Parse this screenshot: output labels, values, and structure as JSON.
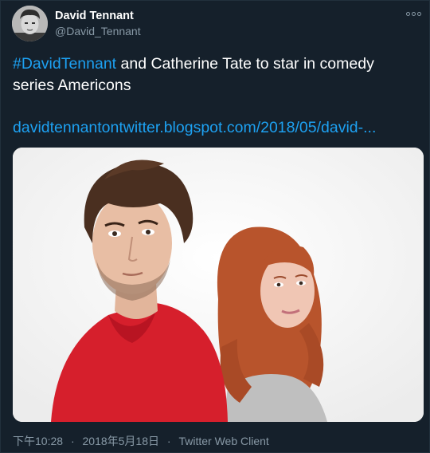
{
  "author": {
    "display_name": "David Tennant",
    "handle": "@David_Tennant",
    "avatar_icon": "avatar-photo"
  },
  "tweet": {
    "hashtag": "#DavidTennant",
    "text_rest": " and Catherine Tate to star in comedy series Americons",
    "link": "davidtennantontwitter.blogspot.com/2018/05/david-..."
  },
  "footer": {
    "time": "下午10:28",
    "date": "2018年5月18日",
    "separator": "·",
    "client": "Twitter Web Client"
  },
  "colors": {
    "background": "#15202b",
    "link": "#1da1f2",
    "secondary": "#8899a6"
  },
  "icons": {
    "more": "more-options-icon"
  }
}
